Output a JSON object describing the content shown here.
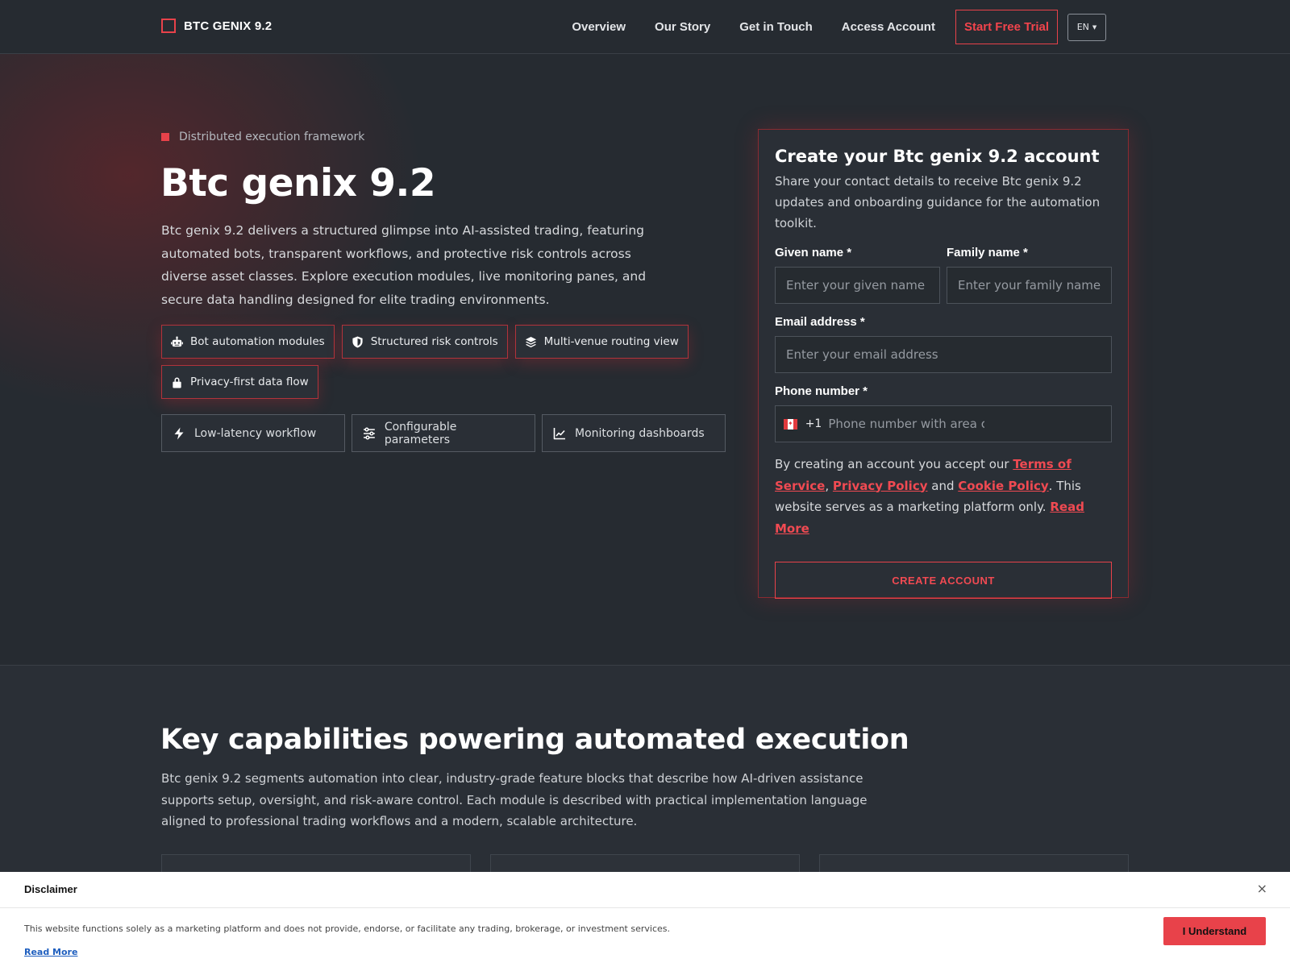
{
  "header": {
    "brand": "BTC GENIX 9.2",
    "nav": [
      "Overview",
      "Our Story",
      "Get in Touch",
      "Access Account"
    ],
    "cta": "Start Free Trial",
    "language": "EN"
  },
  "hero": {
    "eyebrow": "Distributed execution framework",
    "title": "Btc genix 9.2",
    "description": "Btc genix 9.2 delivers a structured glimpse into AI-assisted trading, featuring automated bots, transparent workflows, and protective risk controls across diverse asset classes. Explore execution modules, live monitoring panes, and secure data handling designed for elite trading environments.",
    "chips": [
      {
        "label": "Bot automation modules",
        "icon": "robot-icon"
      },
      {
        "label": "Structured risk controls",
        "icon": "shield-icon"
      },
      {
        "label": "Multi-venue routing view",
        "icon": "layers-icon"
      },
      {
        "label": "Privacy-first data flow",
        "icon": "lock-icon"
      }
    ],
    "features": [
      {
        "label": "Low-latency workflow",
        "icon": "bolt-icon"
      },
      {
        "label": "Configurable parameters",
        "icon": "sliders-icon"
      },
      {
        "label": "Monitoring dashboards",
        "icon": "chart-line-icon"
      }
    ]
  },
  "form": {
    "title": "Create your Btc genix 9.2 account",
    "subtitle": "Share your contact details to receive Btc genix 9.2 updates and onboarding guidance for the automation toolkit.",
    "given_name": {
      "label": "Given name *",
      "placeholder": "Enter your given name"
    },
    "family_name": {
      "label": "Family name *",
      "placeholder": "Enter your family name"
    },
    "email": {
      "label": "Email address *",
      "placeholder": "Enter your email address"
    },
    "phone": {
      "label": "Phone number *",
      "dial_code": "+1",
      "placeholder": "Phone number with area code",
      "flag": "canada-flag-icon"
    },
    "legal": {
      "prefix": "By creating an account you accept our ",
      "terms": "Terms of Service",
      "comma": ",",
      "privacy": "Privacy Policy",
      "and": " and ",
      "cookie": "Cookie Policy",
      "suffix": ". This website serves as a marketing platform only. ",
      "read_more": "Read More"
    },
    "submit": "CREATE ACCOUNT"
  },
  "capabilities": {
    "title": "Key capabilities powering automated execution",
    "description": "Btc genix 9.2 segments automation into clear, industry-grade feature blocks that describe how AI-driven assistance supports setup, oversight, and risk-aware control. Each module is described with practical implementation language aligned to professional trading workflows and a modern, scalable architecture."
  },
  "disclaimer": {
    "title": "Disclaimer",
    "close": "×",
    "text": "This website functions solely as a marketing platform and does not provide, endorse, or facilitate any trading, brokerage, or investment services.",
    "read_more": "Read More",
    "accept": "I Understand"
  },
  "colors": {
    "accent": "#e8424a",
    "background": "#262b31",
    "surface": "#2a2f36"
  }
}
